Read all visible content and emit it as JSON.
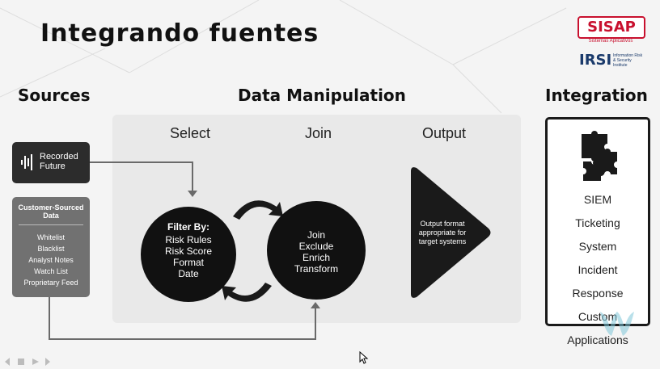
{
  "slide": {
    "title": "Integrando fuentes",
    "logos": {
      "sisap": "SISAP",
      "sisap_sub": "Sistemas Aplicativos",
      "irsi": "IRSI",
      "irsi_sub": "Information Risk & Security Institute"
    },
    "headers": {
      "sources": "Sources",
      "manipulation": "Data Manipulation",
      "integration": "Integration"
    },
    "columns": {
      "select": "Select",
      "join": "Join",
      "output": "Output"
    },
    "sources": {
      "recorded_future": "Recorded Future",
      "recorded_future_l1": "Recorded",
      "recorded_future_l2": "Future",
      "customer_title_l1": "Customer-Sourced",
      "customer_title_l2": "Data",
      "customer_items": [
        "Whitelist",
        "Blacklist",
        "Analyst Notes",
        "Watch List",
        "Proprietary Feed"
      ]
    },
    "filter": {
      "title": "Filter By:",
      "items": [
        "Risk Rules",
        "Risk Score",
        "Format",
        "Date"
      ]
    },
    "join_ops": [
      "Join",
      "Exclude",
      "Enrich",
      "Transform"
    ],
    "output_text": {
      "l1": "Output format",
      "l2": "appropriate for",
      "l3": "target systems"
    },
    "integration": {
      "items": [
        {
          "l1": "SIEM",
          "l2": ""
        },
        {
          "l1": "Ticketing",
          "l2": "System"
        },
        {
          "l1": "Incident",
          "l2": "Response"
        },
        {
          "l1": "Custom",
          "l2": "Applications"
        }
      ]
    },
    "colors": {
      "dark": "#111111",
      "panel": "#e9e9e9",
      "source_gray": "#717171",
      "brand_red": "#c8102e",
      "brand_blue": "#1a3a6b"
    },
    "icons": [
      "recorded-future-logo-icon",
      "puzzle-icon",
      "cycle-arrows-icon",
      "output-triangle-icon",
      "watermark-icon",
      "cursor-icon"
    ]
  }
}
